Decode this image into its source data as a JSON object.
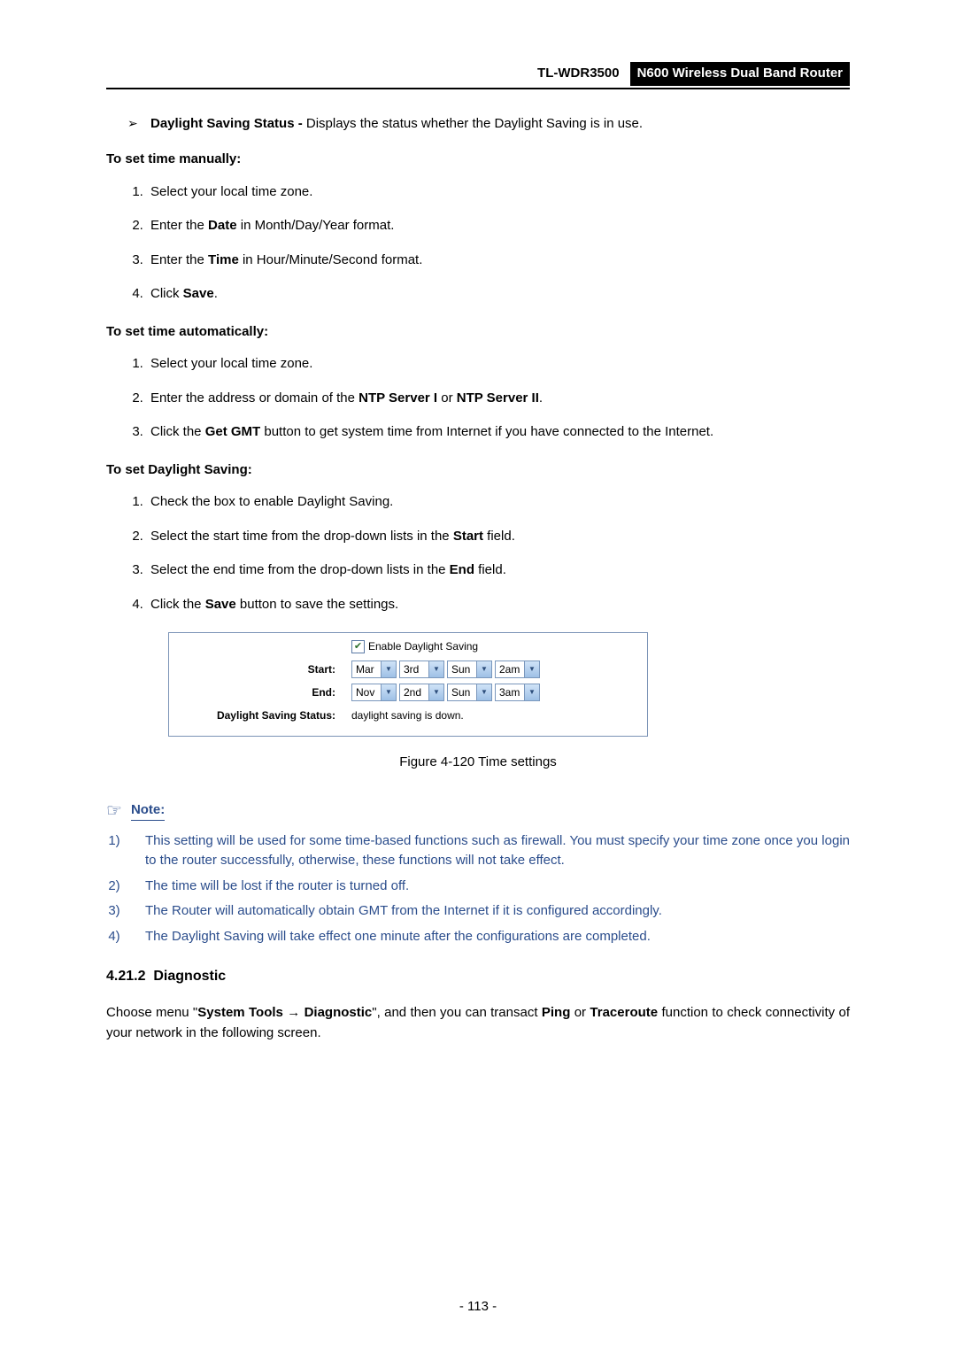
{
  "header": {
    "model": "TL-WDR3500",
    "product": "N600 Wireless Dual Band Router"
  },
  "bullet": {
    "term": "Daylight Saving Status - ",
    "desc": "Displays the status whether the Daylight Saving is in use."
  },
  "manual": {
    "heading": "To set time manually:",
    "i1_a": "Select your local time zone.",
    "i2_a": "Enter the ",
    "i2_b": "Date",
    "i2_c": " in Month/Day/Year format.",
    "i3_a": "Enter the ",
    "i3_b": "Time",
    "i3_c": " in Hour/Minute/Second format.",
    "i4_a": "Click ",
    "i4_b": "Save",
    "i4_c": "."
  },
  "auto": {
    "heading": "To set time automatically:",
    "i1": "Select your local time zone.",
    "i2_a": "Enter the address or domain of the ",
    "i2_b": "NTP Server I",
    "i2_c": " or ",
    "i2_d": "NTP Server II",
    "i2_e": ".",
    "i3_a": "Click the ",
    "i3_b": "Get GMT",
    "i3_c": " button to get system time from Internet if you have connected to the Internet."
  },
  "dst": {
    "heading": "To set Daylight Saving:",
    "i1": "Check the box to enable Daylight Saving.",
    "i2_a": "Select the start time from the drop-down lists in the ",
    "i2_b": "Start",
    "i2_c": " field.",
    "i3_a": "Select the end time from the drop-down lists in the ",
    "i3_b": "End",
    "i3_c": " field.",
    "i4_a": "Click the ",
    "i4_b": "Save",
    "i4_c": " button to save the settings."
  },
  "figure": {
    "enable_label": "Enable Daylight Saving",
    "start_label": "Start:",
    "end_label": "End:",
    "status_label": "Daylight Saving Status:",
    "status_value": "daylight saving is down.",
    "start": {
      "month": "Mar",
      "week": "3rd",
      "day": "Sun",
      "hour": "2am"
    },
    "end": {
      "month": "Nov",
      "week": "2nd",
      "day": "Sun",
      "hour": "3am"
    },
    "caption": "Figure 4-120 Time settings"
  },
  "note": {
    "label": "Note:",
    "n1": "This setting will be used for some time-based functions such as firewall. You must specify your time zone once you login to the router successfully, otherwise, these functions will not take effect.",
    "n2": "The time will be lost if the router is turned off.",
    "n3": "The Router will automatically obtain GMT from the Internet if it is configured accordingly.",
    "n4": "The Daylight Saving will take effect one minute after the configurations are completed."
  },
  "section": {
    "num": "4.21.2",
    "title": "Diagnostic",
    "p_a": "Choose menu \"",
    "p_b": "System Tools",
    "p_c": " → ",
    "p_d": "Diagnostic",
    "p_e": "\", and then you can transact ",
    "p_f": "Ping",
    "p_g": " or ",
    "p_h": "Traceroute",
    "p_i": " function to check connectivity of your network in the following screen."
  },
  "pagenum": "- 113 -"
}
